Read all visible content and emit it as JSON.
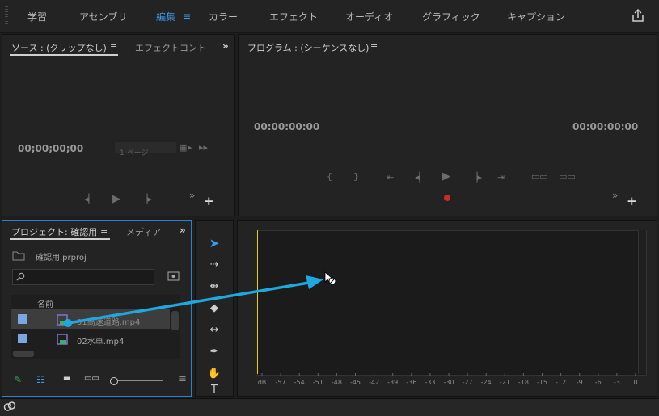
{
  "workspaces": [
    "学習",
    "アセンブリ",
    "編集",
    "カラー",
    "エフェクト",
    "オーディオ",
    "グラフィック",
    "キャプション"
  ],
  "active_workspace": "編集",
  "source_panel": {
    "tab1": "ソース : (クリップなし)",
    "tab2": "エフェクトコント",
    "timecode": "00;00;00;00",
    "page_field": "1 ページ"
  },
  "program_panel": {
    "title": "プログラム : (シーケンスなし)",
    "timecode_left": "00:00:00:00",
    "timecode_right": "00:00:00:00"
  },
  "project_panel": {
    "tab1": "プロジェクト: 確認用",
    "tab2": "メディア",
    "project_file": "確認用.prproj",
    "column_header": "名前",
    "items": [
      {
        "name": "01高速道路.mp4"
      },
      {
        "name": "02水車.mp4"
      }
    ]
  },
  "timeline": {
    "ruler_labels": [
      "dB",
      "-57",
      "-54",
      "-51",
      "-48",
      "-45",
      "-42",
      "-39",
      "-36",
      "-33",
      "-30",
      "-27",
      "-24",
      "-21",
      "-18",
      "-15",
      "-12",
      "-9",
      "-6",
      "-3",
      "0"
    ]
  },
  "colors": {
    "accent": "#3d9be9",
    "arrow": "#1fa8e0",
    "playhead": "#e5d000",
    "record": "#c92b2b",
    "clip_icon": "#8a6fd0"
  }
}
